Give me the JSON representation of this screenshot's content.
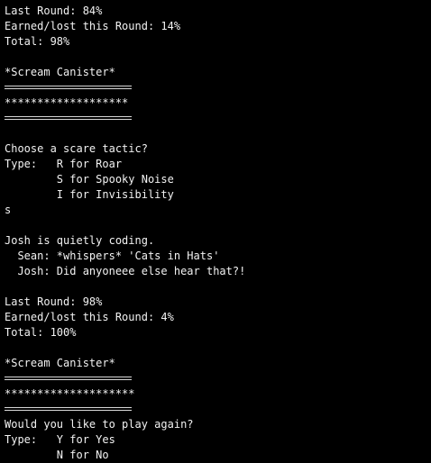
{
  "terminal": {
    "lines": [
      "Last Round: 84%",
      "Earned/lost this Round: 14%",
      "Total: 98%",
      "",
      "*Scream Canister*",
      "",
      "*******************",
      "",
      "",
      "Choose a scare tactic?",
      "Type:   R for Roar",
      "        S for Spooky Noise",
      "        I for Invisibility",
      "s",
      "",
      "Josh is quietly coding.",
      "  Sean: *whispers* 'Cats in Hats'",
      "  Josh: Did anyoneee else hear that?!",
      "",
      "Last Round: 98%",
      "Earned/lost this Round: 4%",
      "Total: 100%",
      "",
      "*Scream Canister*",
      "",
      "********************",
      "",
      "Would you like to play again?",
      "Type:   Y for Yes",
      "        N for No"
    ]
  }
}
